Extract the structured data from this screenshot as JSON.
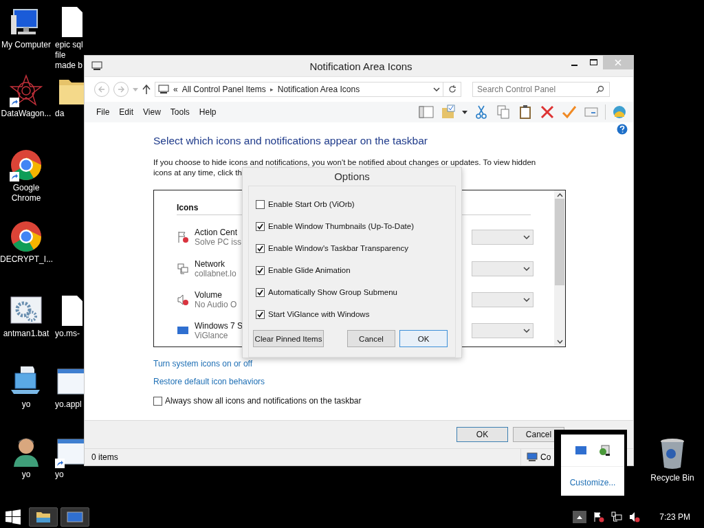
{
  "desktop": {
    "rows": [
      {
        "icons": [
          {
            "label": "My Computer",
            "kind": "computer",
            "shortcut": false
          },
          {
            "label": "epic sql file made b",
            "kind": "document",
            "shortcut": false
          }
        ]
      },
      {
        "icons": [
          {
            "label": "DataWagon...",
            "kind": "star",
            "shortcut": true
          },
          {
            "label": "da",
            "kind": "folder",
            "shortcut": false
          }
        ]
      },
      {
        "icons": [
          {
            "label": "Google Chrome",
            "kind": "chrome",
            "shortcut": true
          }
        ]
      },
      {
        "icons": [
          {
            "label": "DECRYPT_I...",
            "kind": "chrome",
            "shortcut": false
          }
        ]
      },
      {
        "icons": [
          {
            "label": "antman1.bat",
            "kind": "gears",
            "shortcut": false
          },
          {
            "label": "yo.ms-",
            "kind": "document",
            "shortcut": false
          }
        ]
      },
      {
        "icons": [
          {
            "label": "yo",
            "kind": "laptop",
            "shortcut": false
          },
          {
            "label": "yo.appl",
            "kind": "appwindow",
            "shortcut": false
          }
        ]
      },
      {
        "icons": [
          {
            "label": "yo",
            "kind": "user",
            "shortcut": false
          },
          {
            "label": "yo",
            "kind": "appwindow",
            "shortcut": true
          }
        ]
      }
    ],
    "recycle_bin": {
      "label": "Recycle Bin"
    }
  },
  "window": {
    "title": "Notification Area Icons",
    "address": {
      "separator": "«",
      "crumbs": [
        "All Control Panel Items",
        "Notification Area Icons"
      ],
      "crumb_arrow": "▸"
    },
    "search": {
      "placeholder": "Search Control Panel"
    },
    "menu": [
      "File",
      "Edit",
      "View",
      "Tools",
      "Help"
    ],
    "heading": "Select which icons and notifications appear on the taskbar",
    "intro": "If you choose to hide icons and notifications, you won't be notified about changes or updates. To view hidden icons at any time, click th",
    "list": {
      "header": "Icons",
      "items": [
        {
          "name": "Action Cent",
          "detail": "Solve PC iss",
          "kind": "flag"
        },
        {
          "name": "Network",
          "detail": "collabnet.lo",
          "kind": "network"
        },
        {
          "name": "Volume",
          "detail": "No Audio O",
          "kind": "volume"
        },
        {
          "name": "Windows 7 S",
          "detail": "ViGlance",
          "kind": "screen"
        }
      ]
    },
    "links": [
      "Turn system icons on or off",
      "Restore default icon behaviors"
    ],
    "always_show": {
      "label": "Always show all icons and notifications on the taskbar",
      "checked": false
    },
    "buttons": [
      "OK",
      "Cancel"
    ],
    "status_bar": {
      "items": "0 items",
      "zone": "Co"
    }
  },
  "options_dialog": {
    "title": "Options",
    "options": [
      {
        "label": "Enable Start Orb (ViOrb)",
        "checked": false
      },
      {
        "label": "Enable Window Thumbnails (Up-To-Date)",
        "checked": true
      },
      {
        "label": "Enable Window's Taskbar Transparency",
        "checked": true
      },
      {
        "label": "Enable Glide Animation",
        "checked": true
      },
      {
        "label": "Automatically Show Group Submenu",
        "checked": true
      },
      {
        "label": "Start ViGlance with Windows",
        "checked": true
      }
    ],
    "buttons": [
      {
        "label": "Clear Pinned Items",
        "default": false
      },
      {
        "label": "Cancel",
        "default": false
      },
      {
        "label": "OK",
        "default": true
      }
    ]
  },
  "tray_popup": {
    "link": "Customize..."
  },
  "taskbar": {
    "apps": [
      {
        "kind": "explorer"
      },
      {
        "kind": "screen"
      }
    ],
    "clock": "7:23 PM"
  }
}
